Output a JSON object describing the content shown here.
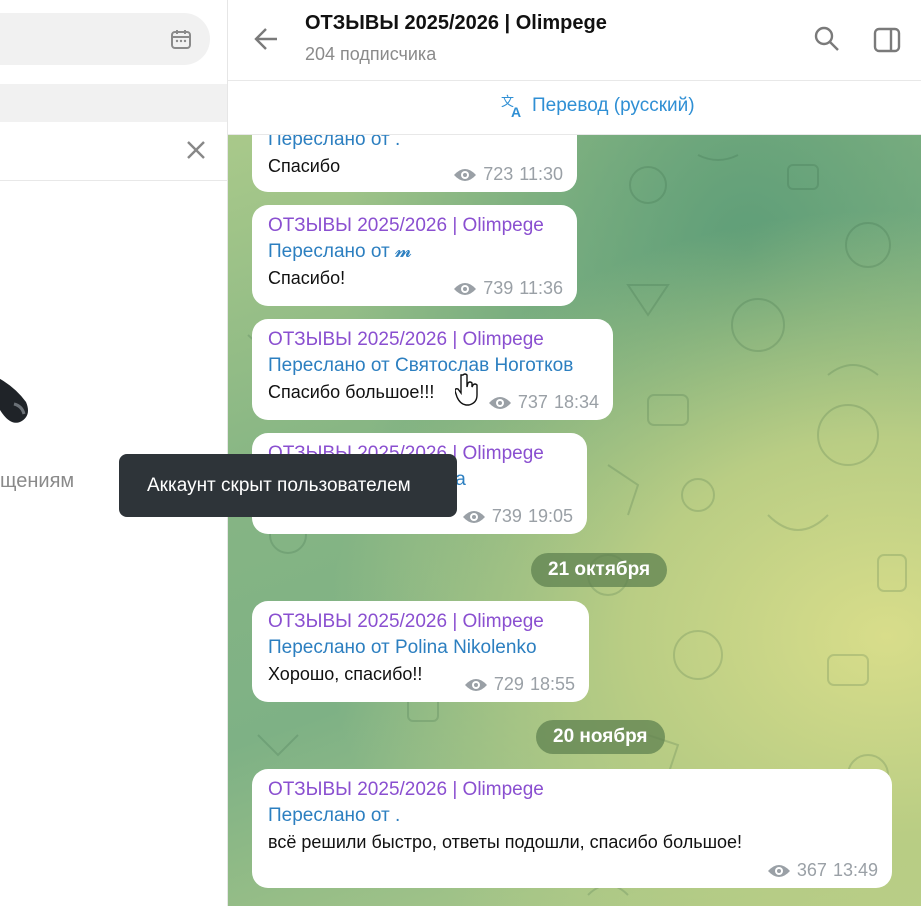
{
  "left": {
    "hint": "щениям"
  },
  "header": {
    "title": "ОТЗЫВЫ 2025/2026 | Olimpege",
    "subtitle": "204 подписчика"
  },
  "translate": {
    "label": "Перевод (русский)"
  },
  "messages": [
    {
      "source": "",
      "forwarded": "Переслано от .",
      "text": "Спасибо",
      "views": "723",
      "time": "11:30"
    },
    {
      "source": "ОТЗЫВЫ 2025/2026 | Olimpege",
      "forwarded": "Переслано от 𝓶",
      "text": "Спасибо!",
      "views": "739",
      "time": "11:36"
    },
    {
      "source": "ОТЗЫВЫ 2025/2026 | Olimpege",
      "forwarded": "Переслано от Святослав Ноготков",
      "text": "Спасибо большое!!!",
      "views": "737",
      "time": "18:34"
    },
    {
      "source": "ОТЗЫВЫ 2025/2026 | Olimpege",
      "forwarded": "Переслано от Татьяна",
      "text": "Спасибо большое",
      "views": "739",
      "time": "19:05"
    },
    {
      "source": "ОТЗЫВЫ 2025/2026 | Olimpege",
      "forwarded": "Переслано от Polina Nikolenko",
      "text": "Хорошо, спасибо!!",
      "views": "729",
      "time": "18:55"
    },
    {
      "source": "ОТЗЫВЫ 2025/2026 | Olimpege",
      "forwarded": "Переслано от .",
      "text": "всё решили быстро, ответы подошли, спасибо большое!",
      "views": "367",
      "time": "13:49"
    }
  ],
  "dates": [
    "21 октября",
    "20 ноября"
  ],
  "tooltip": "Аккаунт скрыт пользователем",
  "colors": {
    "accent": "#2f8fd4",
    "channel_name": "#8a4fd0",
    "forwarded": "#2c7fc0"
  }
}
